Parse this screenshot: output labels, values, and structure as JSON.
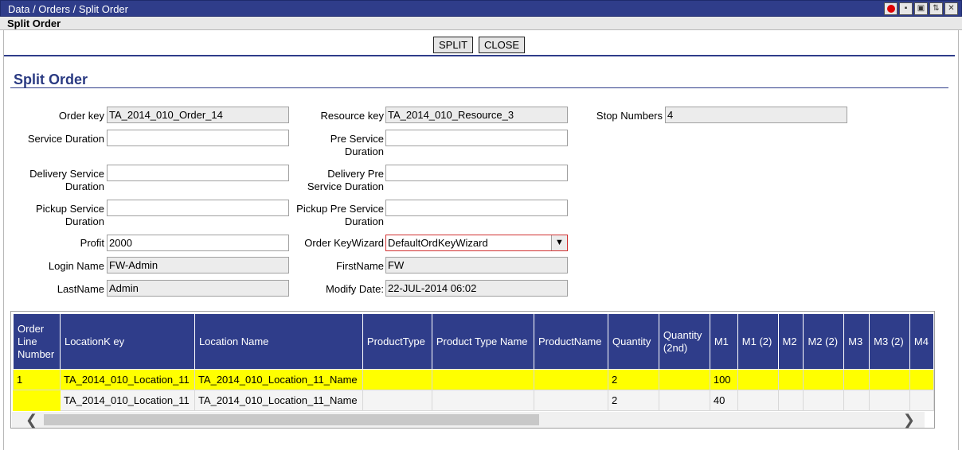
{
  "window": {
    "breadcrumb": "Data / Orders / Split Order",
    "subtitle": "Split Order",
    "icons": [
      "record-icon",
      "save-icon",
      "lock-icon",
      "refresh-icon",
      "close-icon"
    ],
    "icon_glyphs": {
      "save": "▪",
      "lock": "▣",
      "refresh": "⇅",
      "close": "✕"
    }
  },
  "toolbar": {
    "split_label": "SPLIT",
    "close_label": "CLOSE"
  },
  "form": {
    "heading": "Split Order",
    "order_key": {
      "label": "Order key",
      "value": "TA_2014_010_Order_14"
    },
    "resource_key": {
      "label": "Resource key",
      "value": "TA_2014_010_Resource_3"
    },
    "stop_numbers": {
      "label": "Stop Numbers",
      "value": "4"
    },
    "service_duration": {
      "label": "Service Duration",
      "value": ""
    },
    "pre_service_duration": {
      "label1": "Pre Service",
      "label2": "Duration",
      "value": ""
    },
    "delivery_service_duration": {
      "label1": "Delivery Service",
      "label2": "Duration",
      "value": ""
    },
    "delivery_pre_service_duration": {
      "label1": "Delivery Pre",
      "label2": "Service Duration",
      "value": ""
    },
    "pickup_service_duration": {
      "label1": "Pickup Service",
      "label2": "Duration",
      "value": ""
    },
    "pickup_pre_service_duration": {
      "label1": "Pickup Pre Service",
      "label2": "Duration",
      "value": ""
    },
    "profit": {
      "label": "Profit",
      "value": "2000"
    },
    "order_key_wizard": {
      "label": "Order KeyWizard",
      "value": "DefaultOrdKeyWizard",
      "arrow": "▼"
    },
    "login_name": {
      "label": "Login Name",
      "value": "FW-Admin"
    },
    "first_name": {
      "label": "FirstName",
      "value": "FW"
    },
    "last_name": {
      "label": "LastName",
      "value": "Admin"
    },
    "modify_date": {
      "label": "Modify Date:",
      "value": "22-JUL-2014 06:02"
    }
  },
  "grid": {
    "columns": [
      {
        "label": "Order Line Number"
      },
      {
        "label": "LocationK ey"
      },
      {
        "label": "Location Name"
      },
      {
        "label": "ProductType"
      },
      {
        "label": "Product Type Name"
      },
      {
        "label": "ProductName"
      },
      {
        "label": "Quantity"
      },
      {
        "label": "Quantity (2nd)"
      },
      {
        "label": "M1"
      },
      {
        "label": "M1 (2)"
      },
      {
        "label": "M2"
      },
      {
        "label": "M2 (2)"
      },
      {
        "label": "M3"
      },
      {
        "label": "M3 (2)"
      },
      {
        "label": "M4"
      }
    ],
    "rows": [
      [
        "1",
        "TA_2014_010_Location_11",
        "TA_2014_010_Location_11_Name",
        "",
        "",
        "",
        "2",
        "",
        "100",
        "",
        "",
        "",
        "",
        "",
        ""
      ],
      [
        "",
        "TA_2014_010_Location_11",
        "TA_2014_010_Location_11_Name",
        "",
        "",
        "",
        "2",
        "",
        "40",
        "",
        "",
        "",
        "",
        "",
        ""
      ]
    ],
    "selected_row": 0,
    "scroll_left": "❮",
    "scroll_right": "❯"
  }
}
